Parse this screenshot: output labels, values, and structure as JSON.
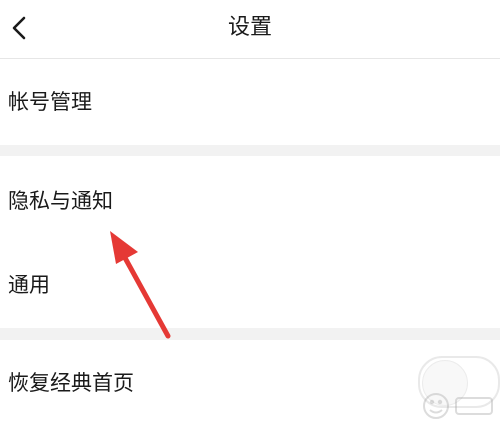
{
  "header": {
    "title": "设置"
  },
  "menu": {
    "items": [
      {
        "label": "帐号管理"
      },
      {
        "label": "隐私与通知"
      },
      {
        "label": "通用"
      },
      {
        "label": "恢复经典首页"
      }
    ]
  },
  "colors": {
    "arrow": "#e53935",
    "section_gap": "#f2f2f2",
    "divider": "#e6e6e6"
  },
  "icons": {
    "back": "chevron-left-icon",
    "annotation": "red-arrow-icon",
    "toggle": "toggle-switch-icon"
  }
}
